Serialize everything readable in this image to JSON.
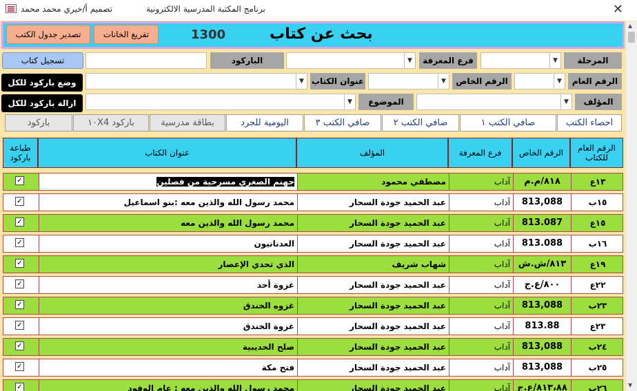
{
  "titlebar": {
    "designer": "تصميم أ/خيري محمد محمد",
    "app_title": "برنامج المكتبة المدرسية الالكترونية",
    "close": "✕"
  },
  "header": {
    "title": "بحث عن كتاب",
    "count": "1300",
    "clear_fields": "تفريغ الخانات",
    "export_table": "تصدير جدول الكتب"
  },
  "form": {
    "stage_label": "المرحلة",
    "branch_label": "فرع المعرفة",
    "barcode_label": "الباركود",
    "register_book": "تسجيل كتاب",
    "general_no_label": "الرقم العام",
    "special_no_label": "الرقم الخاص",
    "book_title_label": "عنوان الكتاب",
    "set_barcode_all": "وضع باركود للكل",
    "author_label": "المؤلف",
    "subject_label": "الموضوع",
    "remove_barcode_all": "ازالة باركود للكل"
  },
  "tabs": [
    "احصاء الكتب",
    "صافي الكتب ١",
    "صافي الكتب ٢",
    "صافي الكتب ٣",
    "اليومية للجرد",
    "بطاقة مدرسية",
    "باركود ١٠X4",
    "باركود"
  ],
  "table": {
    "headers": {
      "general_no": "الرقم العام للكتاب",
      "special_no": "الرقم الخاص",
      "branch": "فرع المعرفة",
      "author": "المؤلف",
      "title": "عنوان الكتاب",
      "print_barcode": "طباعة باركود"
    },
    "rows": [
      {
        "general": "١٣ع",
        "special": "٨١٨/م.م",
        "branch": "آداب",
        "author": "مصطفي محمود",
        "title": "جهنم الصغري مسرحية من فصلين",
        "checked": "✓"
      },
      {
        "general": "١٥ب",
        "special": "813,088",
        "branch": "آداب",
        "author": "عبد الحميد جودة السحار",
        "title": "محمد رسول الله والذين معه :بنو اسماعيل",
        "checked": "✓"
      },
      {
        "general": "١٥ع",
        "special": "813.087",
        "branch": "آداب",
        "author": "عبد الحميد جودة السحار",
        "title": "محمد رسول الله والذين معه",
        "checked": "✓"
      },
      {
        "general": "١٦ب",
        "special": "813.088",
        "branch": "آداب",
        "author": "عبد الحميد جودة السحار",
        "title": "العدنانيون",
        "checked": "✓"
      },
      {
        "general": "١٩ع",
        "special": "٨١٣/ش.ش",
        "branch": "آداب",
        "author": "شهاب شريف",
        "title": "الذي تحدي الإعصار",
        "checked": "✓"
      },
      {
        "general": "٢٢ع",
        "special": "٨٠٠/ع.ج",
        "branch": "آداب",
        "author": "عبد الحميد جودة السحار",
        "title": "غزوة أحد",
        "checked": "✓"
      },
      {
        "general": "٢٣ب",
        "special": "813,088",
        "branch": "آداب",
        "author": "عبد الحميد جودة السحار",
        "title": "غزوه الخندق",
        "checked": "✓"
      },
      {
        "general": "٢٣ع",
        "special": "813.88",
        "branch": "آداب",
        "author": "عبد الحميد جودة السحار",
        "title": "غزوة الخندق",
        "checked": "✓"
      },
      {
        "general": "٢٤ب",
        "special": "813,088",
        "branch": "آداب",
        "author": "عبد الحميد جودة السحار",
        "title": "صلح الحديبية",
        "checked": "✓"
      },
      {
        "general": "٢٥ب",
        "special": "813,088",
        "branch": "آداب",
        "author": "عبد الحميد جودة السحار",
        "title": "فتح مكة",
        "checked": "✓"
      },
      {
        "general": "٢٦ب",
        "special": "٨١٣،٨٨/ع.ج",
        "branch": "آداب",
        "author": "عبد الحميد جودة السحار",
        "title": "محمد رسول الله والذين معه : عام الوفود",
        "checked": "✓"
      }
    ]
  },
  "colors": {
    "header_bg": "#39d1f2",
    "green_row": "#9dde3f",
    "background": "#fde6a8",
    "label_gray": "#a6a6a6"
  }
}
